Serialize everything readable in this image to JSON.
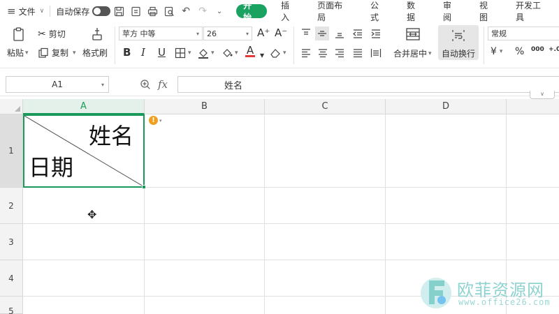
{
  "menubar": {
    "file_label": "文件",
    "autosave_label": "自动保存",
    "tabs": [
      {
        "label": "开始",
        "active": true
      },
      {
        "label": "插入"
      },
      {
        "label": "页面布局"
      },
      {
        "label": "公式"
      },
      {
        "label": "数据"
      },
      {
        "label": "审阅"
      },
      {
        "label": "视图"
      },
      {
        "label": "开发工具"
      }
    ]
  },
  "ribbon": {
    "paste_label": "粘贴",
    "cut_label": "剪切",
    "copy_label": "复制",
    "format_painter_label": "格式刷",
    "font_name": "苹方 中等",
    "font_size": "26",
    "bold_glyph": "B",
    "italic_glyph": "I",
    "underline_glyph": "U",
    "grow_font_glyph": "A⁺",
    "shrink_font_glyph": "A⁻",
    "font_color_glyph": "A",
    "merge_center_label": "合并居中",
    "wrap_text_label": "自动换行",
    "number_format": "常规",
    "currency_glyph": "¥",
    "percent_glyph": "%",
    "thousands_glyph": "000",
    "decimal_glyph": "+.0",
    "accent_color": "#1aa260",
    "font_color_bar": "#e53935"
  },
  "formula_bar": {
    "name_box": "A1",
    "content": "姓名"
  },
  "sheet": {
    "columns": [
      "A",
      "B",
      "C",
      "D"
    ],
    "rows": [
      "1",
      "2",
      "3",
      "4",
      "5"
    ],
    "a1_top_right": "姓名",
    "a1_bottom_left": "日期",
    "selection_color": "#1a9a5a",
    "warning_glyph": "!"
  },
  "watermark": {
    "brand": "欧菲资源网",
    "url": "www.office26.com"
  }
}
